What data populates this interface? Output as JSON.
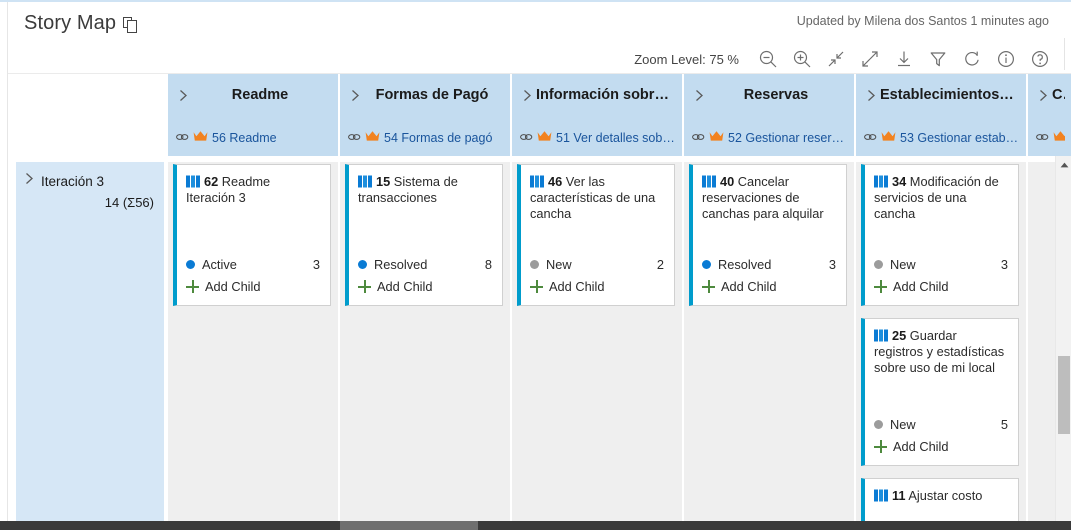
{
  "header": {
    "page_title": "Story Map",
    "copy_icon": "copy-icon",
    "updated_text": "Updated by Milena dos Santos 1 minutes ago",
    "zoom_label": "Zoom Level: 75 %",
    "tools": [
      {
        "name": "zoom-out-icon",
        "label": "Zoom out"
      },
      {
        "name": "zoom-in-icon",
        "label": "Zoom in"
      },
      {
        "name": "collapse-icon",
        "label": "Collapse"
      },
      {
        "name": "expand-icon",
        "label": "Expand"
      },
      {
        "name": "download-icon",
        "label": "Download"
      },
      {
        "name": "filter-icon",
        "label": "Filter"
      },
      {
        "name": "refresh-icon",
        "label": "Refresh"
      },
      {
        "name": "info-icon",
        "label": "Information"
      },
      {
        "name": "help-icon",
        "label": "Help"
      }
    ]
  },
  "board": {
    "row": {
      "name": "Iteración 3",
      "count": "14 (Σ56)",
      "chevron": "chevron-right-icon"
    },
    "columns": [
      {
        "title": "Readme",
        "title_align": "center",
        "epic_id": "56",
        "epic_title": "Readme",
        "cards": [
          {
            "type_icon": "feature-book-icon",
            "id": "62",
            "title": "Readme Iteración 3",
            "state": "Active",
            "state_color": "#0a7bd4",
            "count": "3",
            "add_child": "Add Child"
          }
        ]
      },
      {
        "title": "Formas de Pagó",
        "title_align": "center",
        "epic_id": "54",
        "epic_title": "Formas de pagó",
        "cards": [
          {
            "type_icon": "feature-book-icon",
            "id": "15",
            "title": "Sistema de transacciones",
            "state": "Resolved",
            "state_color": "#0a7bd4",
            "count": "8",
            "add_child": "Add Child"
          }
        ]
      },
      {
        "title": "Información sobre c...",
        "title_align": "left",
        "epic_id": "51",
        "epic_title": "Ver detalles sobr...",
        "cards": [
          {
            "type_icon": "feature-book-icon",
            "id": "46",
            "title": "Ver las características de una cancha",
            "state": "New",
            "state_color": "#9c9c9c",
            "count": "2",
            "add_child": "Add Child"
          }
        ]
      },
      {
        "title": "Reservas",
        "title_align": "center",
        "epic_id": "52",
        "epic_title": "Gestionar reserva...",
        "cards": [
          {
            "type_icon": "feature-book-icon",
            "id": "40",
            "title": "Cancelar reservaciones de canchas para alquilar",
            "state": "Resolved",
            "state_color": "#0a7bd4",
            "count": "3",
            "add_child": "Add Child"
          }
        ]
      },
      {
        "title": "Establecimientos ofr...",
        "title_align": "left",
        "epic_id": "53",
        "epic_title": "Gestionar estable...",
        "cards": [
          {
            "type_icon": "feature-book-icon",
            "id": "34",
            "title": "Modificación de servicios de una cancha",
            "state": "New",
            "state_color": "#9c9c9c",
            "count": "3",
            "add_child": "Add Child"
          },
          {
            "type_icon": "feature-book-icon",
            "id": "25",
            "title": "Guardar registros y estadísticas sobre uso de mi local",
            "state": "New",
            "state_color": "#9c9c9c",
            "count": "5",
            "add_child": "Add Child"
          },
          {
            "type_icon": "feature-book-icon",
            "id": "11",
            "title": "Ajustar costo",
            "state": "",
            "state_color": "",
            "count": "",
            "add_child": ""
          }
        ]
      },
      {
        "title": "C",
        "title_align": "center",
        "epic_id": "",
        "epic_title": "",
        "cards": []
      }
    ]
  },
  "colors": {
    "header_blue": "#c3dcf0",
    "row_blue": "#d6e7f6",
    "lane_gray": "#efefef",
    "card_accent": "#009ccc",
    "epic_crown": "#f2821f",
    "link_text": "#19549c"
  },
  "scrollbars": {
    "vertical": {
      "name": "vertical-scrollbar",
      "up_arrow": "scroll-up-arrow-icon"
    },
    "horizontal": {
      "name": "horizontal-scrollbar"
    }
  }
}
